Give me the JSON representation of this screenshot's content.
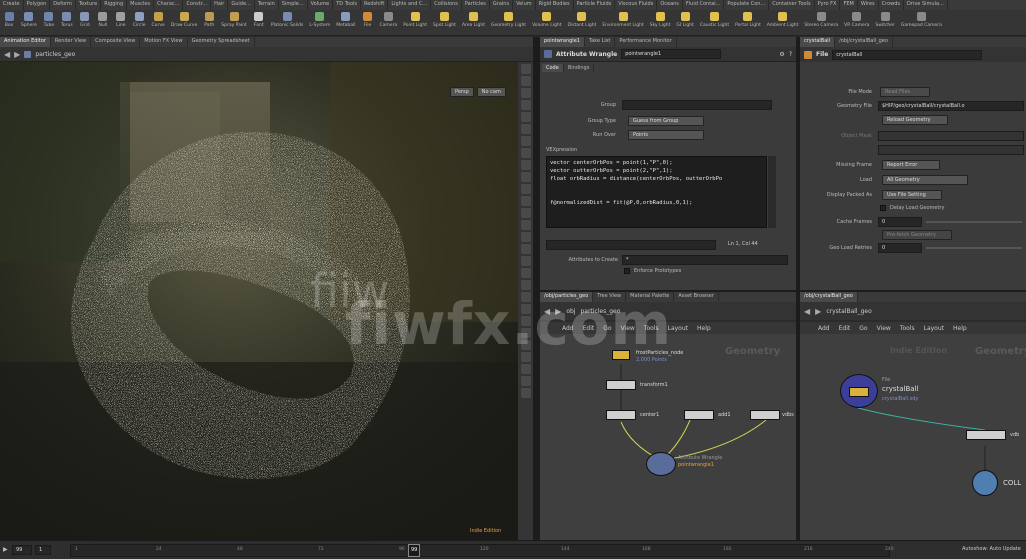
{
  "shelf_tabs": [
    "Create",
    "Polygon",
    "Deform",
    "Texture",
    "Rigging",
    "Muscles",
    "Charac...",
    "Constr...",
    "Hair",
    "Guide...",
    "Terrain",
    "Simple...",
    "Volume",
    "TD Tools",
    "Redshift",
    "Lights and C...",
    "Collisions",
    "Particles",
    "Grains",
    "Velum",
    "Rigid Bodies",
    "Particle Fluids",
    "Viscous Fluids",
    "Oceans",
    "Fluid Contai...",
    "Populate Con...",
    "Container Tools",
    "Pyro FX",
    "FEM",
    "Wires",
    "Crowds",
    "Drive Simula..."
  ],
  "shelf_tools": [
    {
      "label": "Box",
      "color": "#6a7fa8"
    },
    {
      "label": "Sphere",
      "color": "#7c8db5"
    },
    {
      "label": "Tube",
      "color": "#7285ad"
    },
    {
      "label": "Torus",
      "color": "#7b8cb0"
    },
    {
      "label": "Grid",
      "color": "#8896b8"
    },
    {
      "label": "Null",
      "color": "#9a9a9a"
    },
    {
      "label": "Line",
      "color": "#a0a0a0"
    },
    {
      "label": "Circle",
      "color": "#8f9fbf"
    },
    {
      "label": "Curve",
      "color": "#c2a14a"
    },
    {
      "label": "Draw Curve",
      "color": "#c9a84e"
    },
    {
      "label": "Path",
      "color": "#b89b55"
    },
    {
      "label": "Spray Paint",
      "color": "#c0a050"
    },
    {
      "label": "Font",
      "color": "#cccccc"
    },
    {
      "label": "Platonic Solids",
      "color": "#7a8ab0"
    },
    {
      "label": "L-System",
      "color": "#6fa86f"
    },
    {
      "label": "Metaball",
      "color": "#8a9bbf"
    },
    {
      "label": "File",
      "color": "#d08a3a"
    },
    {
      "label": "Camera",
      "color": "#8a8a8a"
    },
    {
      "label": "Point Light",
      "color": "#e0c050"
    },
    {
      "label": "Spot Light",
      "color": "#e0c050"
    },
    {
      "label": "Area Light",
      "color": "#e0c050"
    },
    {
      "label": "Geometry Light",
      "color": "#e0c050"
    },
    {
      "label": "Volume Light",
      "color": "#e0c050"
    },
    {
      "label": "Distant Light",
      "color": "#e0c050"
    },
    {
      "label": "Environment Light",
      "color": "#e0c050"
    },
    {
      "label": "Sky Light",
      "color": "#e0c050"
    },
    {
      "label": "GI Light",
      "color": "#e0c050"
    },
    {
      "label": "Caustic Light",
      "color": "#e0c050"
    },
    {
      "label": "Portal Light",
      "color": "#e0c050"
    },
    {
      "label": "Ambient Light",
      "color": "#e0c050"
    },
    {
      "label": "Stereo Camera",
      "color": "#8a8a8a"
    },
    {
      "label": "VR Camera",
      "color": "#8a8a8a"
    },
    {
      "label": "Switcher",
      "color": "#8a8a8a"
    },
    {
      "label": "Gamepad Camera",
      "color": "#8a8a8a"
    }
  ],
  "viewport": {
    "tabs": [
      "Animation Editor",
      "Render View",
      "Composite View",
      "Motion FX View",
      "Geometry Spreadsheet"
    ],
    "path": "particles_geo",
    "persp_label": "Persp",
    "cam_label": "No cam",
    "mode_label": "Indie Edition"
  },
  "param_pane": {
    "tabs": [
      "pointwrangle1",
      "Take List",
      "Performance Monitor"
    ],
    "node_type": "Attribute Wrangle",
    "node_name": "pointwrangle1",
    "subtabs": [
      "Code",
      "Bindings"
    ],
    "group_label": "Group",
    "group_value": "",
    "group_type_label": "Group Type",
    "group_type_value": "Guess from Group",
    "run_over_label": "Run Over",
    "run_over_value": "Points",
    "vex_label": "VEXpression",
    "code_lines": [
      "vector centerOrbPos = point(1,\"P\",0);",
      "vector outterOrbPos = point(2,\"P\",1);",
      "float orbRadius = distance(centerOrbPos, outterOrbPo",
      "",
      "",
      "f@normalizedDist = fit(@P,0,orbRadius,0,1);"
    ],
    "cursor_pos": "Ln 1, Col 44",
    "attr_create_label": "Attributes to Create",
    "attr_create_value": "*",
    "enforce_label": "Enforce Prototypes"
  },
  "net1": {
    "tabs": [
      "/obj/particles_geo",
      "Tree View",
      "Material Palette",
      "Asset Browser"
    ],
    "path_root": "obj",
    "path_node": "particles_geo",
    "menu": [
      "Add",
      "Edit",
      "Go",
      "View",
      "Tools",
      "Layout",
      "Help"
    ],
    "watermark": "Geometry",
    "nodes": {
      "file": "frostParticles_node",
      "file_sub": "",
      "transform": "transform1",
      "null": "center1",
      "add": "add1",
      "add2": "vdbs",
      "wrangle_type": "Attribute Wrangle",
      "wrangle": "pointwrangle1",
      "file_note": "2,000 Points"
    }
  },
  "geo_right": {
    "tabs": [
      "crystalBall",
      "/obj/crystalBall_geo"
    ],
    "path_node": "crystalBall_geo",
    "node_type": "File",
    "node_name": "crystalBall",
    "file_mode_label": "File Mode",
    "file_mode_value": "Read Files",
    "geo_file_label": "Geometry File",
    "geo_file_value": "$HIP/geo/crystalBall/crystalBall.o",
    "reload_label": "Reload Geometry",
    "object_mask_label": "Object Mask",
    "missing_frame_label": "Missing Frame",
    "missing_frame_value": "Report Error",
    "load_label": "Load",
    "load_value": "All Geometry",
    "packed_label": "Display Packed As",
    "packed_value": "Use File Setting",
    "delay_label": "Delay Load Geometry",
    "cache_label": "Cache Frames",
    "cache_value": "0",
    "prefetch_label": "Pre-fetch Geometry",
    "retries_label": "Geo Load Retries",
    "retries_value": "0"
  },
  "net2": {
    "tabs": [
      "/obj/crystalBall_geo"
    ],
    "path_node": "crystalBall_geo",
    "menu": [
      "Add",
      "Edit",
      "Go",
      "View",
      "Tools",
      "Layout",
      "Help"
    ],
    "watermark": "Geometry",
    "watermark2": "Indie Edition",
    "node_type": "File",
    "node_name": "crystalBall",
    "node_file": "crystalBall.sdy",
    "vdb_label": "vdb",
    "coll_label": "COLL"
  },
  "timeline": {
    "frame": "99",
    "start": "1",
    "marker": "99",
    "end_label": "Autoshow: Auto Update",
    "ticks": [
      "1",
      "24",
      "48",
      "72",
      "96",
      "120",
      "144",
      "168",
      "192",
      "216",
      "240"
    ]
  },
  "watermark": "fiwfx.com",
  "colors": {
    "accent": "#e8a33a",
    "node_wrangle": "#5a6c9a",
    "file_node": "#3a3a8a"
  }
}
